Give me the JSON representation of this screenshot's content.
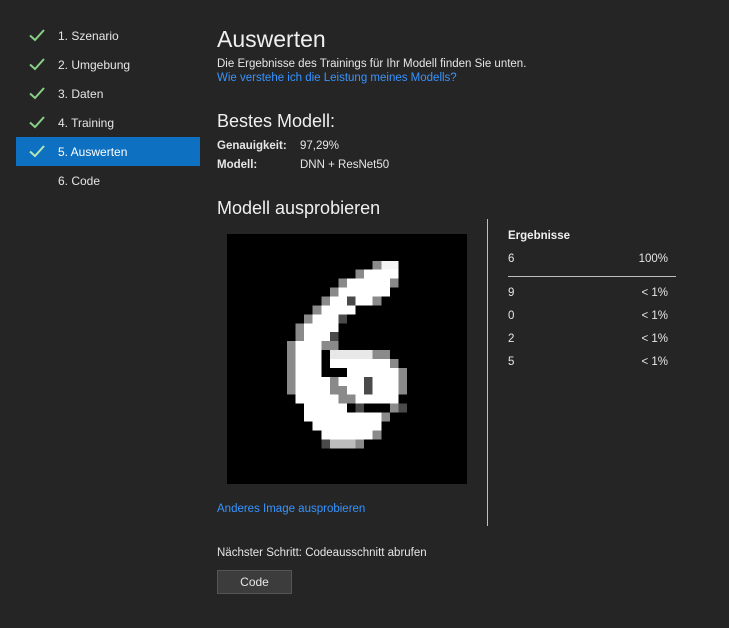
{
  "sidebar": {
    "steps": [
      {
        "label": "1. Szenario",
        "done": true,
        "active": false
      },
      {
        "label": "2. Umgebung",
        "done": true,
        "active": false
      },
      {
        "label": "3. Daten",
        "done": true,
        "active": false
      },
      {
        "label": "4. Training",
        "done": true,
        "active": false
      },
      {
        "label": "5. Auswerten",
        "done": true,
        "active": true
      },
      {
        "label": "6. Code",
        "done": false,
        "active": false
      }
    ]
  },
  "main": {
    "title": "Auswerten",
    "subtitle": "Die Ergebnisse des Trainings für Ihr Modell finden Sie unten.",
    "help_link": "Wie verstehe ich die Leistung meines Modells?",
    "best_model": {
      "heading": "Bestes Modell:",
      "accuracy_label": "Genauigkeit:",
      "accuracy_value": "97,29%",
      "model_label": "Modell:",
      "model_value": "DNN + ResNet50"
    },
    "try_model": {
      "heading": "Modell ausprobieren",
      "another_image_link": "Anderes Image ausprobieren"
    },
    "results": {
      "title": "Ergebnisse",
      "top": {
        "label": "6",
        "value": "100%"
      },
      "others": [
        {
          "label": "9",
          "value": "< 1%"
        },
        {
          "label": "0",
          "value": "< 1%"
        },
        {
          "label": "2",
          "value": "< 1%"
        },
        {
          "label": "5",
          "value": "< 1%"
        }
      ]
    },
    "next_step": {
      "text": "Nächster Schritt: Codeausschnitt abrufen",
      "button_label": "Code"
    }
  },
  "colors": {
    "background": "#252526",
    "active_step": "#0e70c0",
    "link": "#3794ff",
    "check": "#89d185"
  }
}
